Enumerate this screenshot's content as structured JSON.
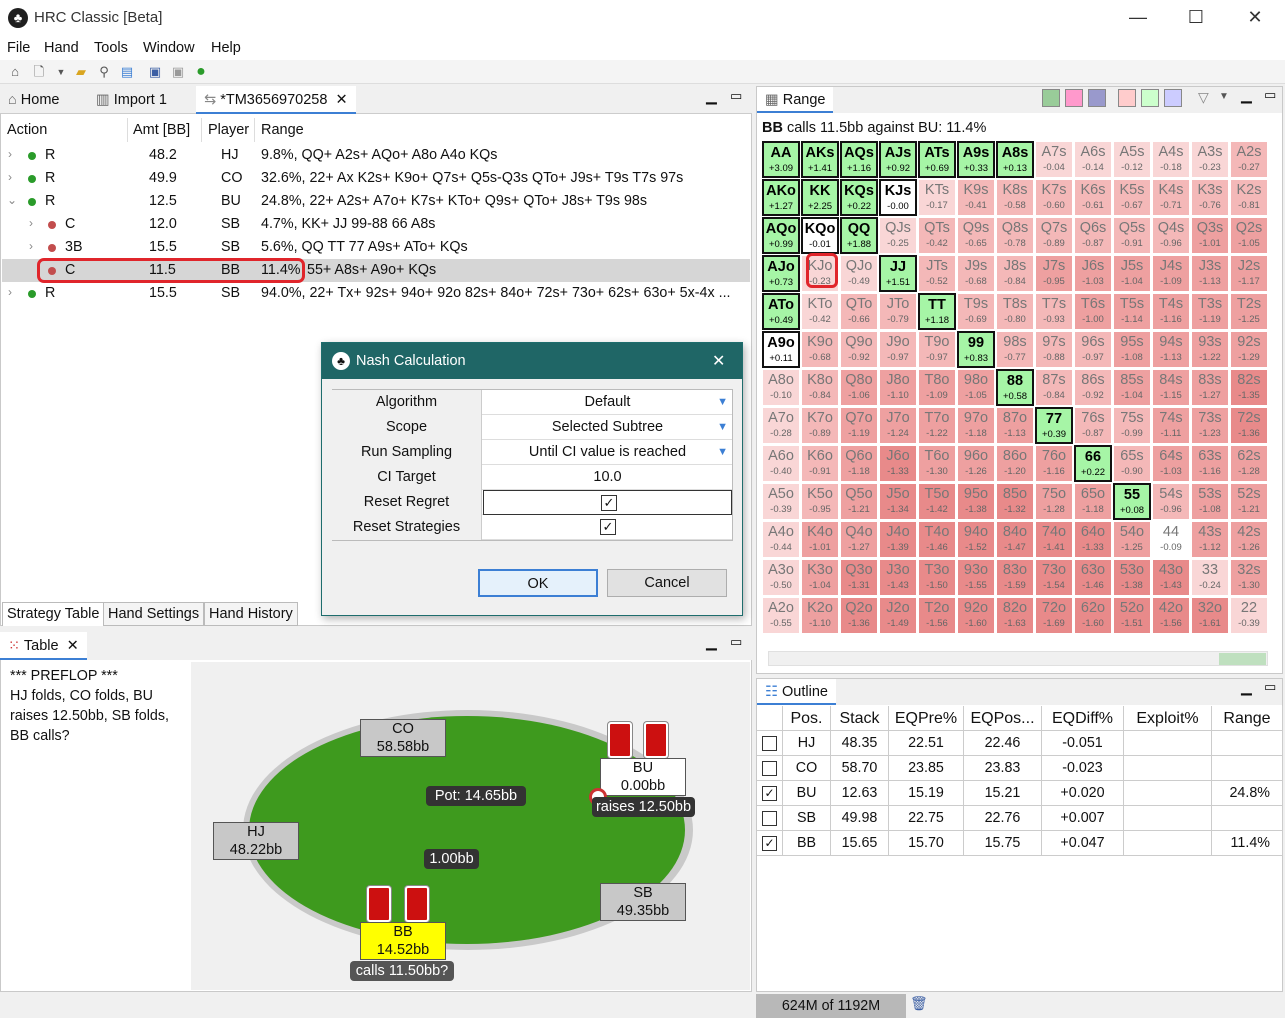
{
  "window": {
    "title": "HRC Classic [Beta]",
    "minimize": "—",
    "maximize": "☐",
    "close": "✕"
  },
  "menu": [
    "File",
    "Hand",
    "Tools",
    "Window",
    "Help"
  ],
  "editor_tabs": {
    "home": "Home",
    "import": "Import 1",
    "tm": "*TM3656970258"
  },
  "strategy_table": {
    "headers": {
      "action": "Action",
      "amt": "Amt [BB]",
      "player": "Player",
      "range": "Range"
    },
    "rows": [
      {
        "action": "R",
        "amt": "48.2",
        "player": "HJ",
        "range": "9.8%, QQ+ A2s+ AQo+ A8o A4o KQs"
      },
      {
        "action": "R",
        "amt": "49.9",
        "player": "CO",
        "range": "32.6%, 22+ Ax K2s+ K9o+ Q7s+ Q5s-Q3s QTo+ J9s+ T9s T7s 97s"
      },
      {
        "action": "R",
        "amt": "12.5",
        "player": "BU",
        "range": "24.8%, 22+ A2s+ A7o+ K7s+ KTo+ Q9s+ QTo+ J8s+ T9s 98s"
      },
      {
        "action": "C",
        "amt": "12.0",
        "player": "SB",
        "range": "4.7%, KK+ JJ 99-88 66 A8s"
      },
      {
        "action": "3B",
        "amt": "15.5",
        "player": "SB",
        "range": "5.6%, QQ TT 77 A9s+ ATo+ KQs"
      },
      {
        "action": "C",
        "amt": "11.5",
        "player": "BB",
        "range_pct": "11.4%",
        "range": "55+ A8s+ A9o+ KQs"
      },
      {
        "action": "R",
        "amt": "15.5",
        "player": "SB",
        "range": "94.0%, 22+ Tx+ 92s+ 94o+ 92o 82s+ 84o+ 72s+ 73o+ 62s+ 63o+ 5x-4x ..."
      }
    ]
  },
  "bottom_tabs": [
    "Strategy Table",
    "Hand Settings",
    "Hand History"
  ],
  "table_panel": {
    "tab": "Table",
    "history": [
      "*** PREFLOP ***",
      "HJ folds, CO folds, BU",
      "raises 12.50bb, SB folds,",
      "BB calls?"
    ],
    "pot": "Pot:    14.65bb",
    "center_bet": "1.00bb",
    "seats": {
      "co": {
        "name": "CO",
        "stack": "58.58bb"
      },
      "bu": {
        "name": "BU",
        "stack": "0.00bb",
        "action": "raises 12.50bb"
      },
      "hj": {
        "name": "HJ",
        "stack": "48.22bb"
      },
      "sb": {
        "name": "SB",
        "stack": "49.35bb"
      },
      "bb": {
        "name": "BB",
        "stack": "14.52bb",
        "action": "calls 11.50bb?"
      }
    }
  },
  "dialog": {
    "title": "Nash Calculation",
    "fields": [
      {
        "label": "Algorithm",
        "value": "Default"
      },
      {
        "label": "Scope",
        "value": "Selected Subtree"
      },
      {
        "label": "Run Sampling",
        "value": "Until CI value is reached"
      },
      {
        "label": "CI Target",
        "value": "10.0"
      },
      {
        "label": "Reset Regret",
        "value": "✓"
      },
      {
        "label": "Reset Strategies",
        "value": "✓"
      }
    ],
    "ok": "OK",
    "cancel": "Cancel"
  },
  "range_panel": {
    "tab": "Range",
    "subtitle_bold": "BB",
    "subtitle": " calls 11.5bb against BU: 11.4%",
    "grid": [
      [
        [
          "AA",
          "+3.09",
          "g"
        ],
        [
          "AKs",
          "+1.41",
          "g"
        ],
        [
          "AQs",
          "+1.16",
          "g"
        ],
        [
          "AJs",
          "+0.92",
          "g"
        ],
        [
          "ATs",
          "+0.69",
          "g"
        ],
        [
          "A9s",
          "+0.33",
          "g"
        ],
        [
          "A8s",
          "+0.13",
          "g"
        ],
        [
          "A7s",
          "-0.04",
          "p0"
        ],
        [
          "A6s",
          "-0.14",
          "p0"
        ],
        [
          "A5s",
          "-0.12",
          "p0"
        ],
        [
          "A4s",
          "-0.18",
          "p0"
        ],
        [
          "A3s",
          "-0.23",
          "p0"
        ],
        [
          "A2s",
          "-0.27",
          "p1"
        ]
      ],
      [
        [
          "AKo",
          "+1.27",
          "g"
        ],
        [
          "KK",
          "+2.25",
          "g"
        ],
        [
          "KQs",
          "+0.22",
          "g"
        ],
        [
          "KJs",
          "-0.00",
          "w"
        ],
        [
          "KTs",
          "-0.17",
          "p0"
        ],
        [
          "K9s",
          "-0.41",
          "p1"
        ],
        [
          "K8s",
          "-0.58",
          "p1"
        ],
        [
          "K7s",
          "-0.60",
          "p1"
        ],
        [
          "K6s",
          "-0.61",
          "p1"
        ],
        [
          "K5s",
          "-0.67",
          "p1"
        ],
        [
          "K4s",
          "-0.71",
          "p1"
        ],
        [
          "K3s",
          "-0.76",
          "p1"
        ],
        [
          "K2s",
          "-0.81",
          "p1"
        ]
      ],
      [
        [
          "AQo",
          "+0.99",
          "g"
        ],
        [
          "KQo",
          "-0.01",
          "w"
        ],
        [
          "QQ",
          "+1.88",
          "g"
        ],
        [
          "QJs",
          "-0.25",
          "p0"
        ],
        [
          "QTs",
          "-0.42",
          "p1"
        ],
        [
          "Q9s",
          "-0.65",
          "p1"
        ],
        [
          "Q8s",
          "-0.78",
          "p1"
        ],
        [
          "Q7s",
          "-0.89",
          "p1"
        ],
        [
          "Q6s",
          "-0.87",
          "p1"
        ],
        [
          "Q5s",
          "-0.91",
          "p1"
        ],
        [
          "Q4s",
          "-0.96",
          "p1"
        ],
        [
          "Q3s",
          "-1.01",
          "p2"
        ],
        [
          "Q2s",
          "-1.05",
          "p2"
        ]
      ],
      [
        [
          "AJo",
          "+0.73",
          "g"
        ],
        [
          "KJo",
          "-0.23",
          "p0"
        ],
        [
          "QJo",
          "-0.49",
          "p0"
        ],
        [
          "JJ",
          "+1.51",
          "g"
        ],
        [
          "JTs",
          "-0.52",
          "p1"
        ],
        [
          "J9s",
          "-0.68",
          "p1"
        ],
        [
          "J8s",
          "-0.84",
          "p1"
        ],
        [
          "J7s",
          "-0.95",
          "p2"
        ],
        [
          "J6s",
          "-1.03",
          "p2"
        ],
        [
          "J5s",
          "-1.04",
          "p2"
        ],
        [
          "J4s",
          "-1.09",
          "p2"
        ],
        [
          "J3s",
          "-1.13",
          "p2"
        ],
        [
          "J2s",
          "-1.17",
          "p2"
        ]
      ],
      [
        [
          "ATo",
          "+0.49",
          "g"
        ],
        [
          "KTo",
          "-0.42",
          "p0"
        ],
        [
          "QTo",
          "-0.66",
          "p1"
        ],
        [
          "JTo",
          "-0.79",
          "p1"
        ],
        [
          "TT",
          "+1.18",
          "g"
        ],
        [
          "T9s",
          "-0.69",
          "p1"
        ],
        [
          "T8s",
          "-0.80",
          "p1"
        ],
        [
          "T7s",
          "-0.93",
          "p1"
        ],
        [
          "T6s",
          "-1.00",
          "p2"
        ],
        [
          "T5s",
          "-1.14",
          "p2"
        ],
        [
          "T4s",
          "-1.16",
          "p2"
        ],
        [
          "T3s",
          "-1.19",
          "p2"
        ],
        [
          "T2s",
          "-1.25",
          "p2"
        ]
      ],
      [
        [
          "A9o",
          "+0.11",
          "w"
        ],
        [
          "K9o",
          "-0.68",
          "p1"
        ],
        [
          "Q9o",
          "-0.92",
          "p1"
        ],
        [
          "J9o",
          "-0.97",
          "p1"
        ],
        [
          "T9o",
          "-0.97",
          "p1"
        ],
        [
          "99",
          "+0.83",
          "g"
        ],
        [
          "98s",
          "-0.77",
          "p1"
        ],
        [
          "97s",
          "-0.88",
          "p1"
        ],
        [
          "96s",
          "-0.97",
          "p1"
        ],
        [
          "95s",
          "-1.08",
          "p2"
        ],
        [
          "94s",
          "-1.13",
          "p2"
        ],
        [
          "93s",
          "-1.22",
          "p2"
        ],
        [
          "92s",
          "-1.29",
          "p2"
        ]
      ],
      [
        [
          "A8o",
          "-0.10",
          "p0"
        ],
        [
          "K8o",
          "-0.84",
          "p1"
        ],
        [
          "Q8o",
          "-1.06",
          "p2"
        ],
        [
          "J8o",
          "-1.10",
          "p2"
        ],
        [
          "T8o",
          "-1.09",
          "p2"
        ],
        [
          "98o",
          "-1.05",
          "p2"
        ],
        [
          "88",
          "+0.58",
          "g"
        ],
        [
          "87s",
          "-0.84",
          "p1"
        ],
        [
          "86s",
          "-0.92",
          "p1"
        ],
        [
          "85s",
          "-1.04",
          "p2"
        ],
        [
          "84s",
          "-1.15",
          "p2"
        ],
        [
          "83s",
          "-1.27",
          "p2"
        ],
        [
          "82s",
          "-1.35",
          "p3"
        ]
      ],
      [
        [
          "A7o",
          "-0.28",
          "p0"
        ],
        [
          "K7o",
          "-0.89",
          "p1"
        ],
        [
          "Q7o",
          "-1.19",
          "p2"
        ],
        [
          "J7o",
          "-1.24",
          "p2"
        ],
        [
          "T7o",
          "-1.22",
          "p2"
        ],
        [
          "97o",
          "-1.18",
          "p2"
        ],
        [
          "87o",
          "-1.13",
          "p2"
        ],
        [
          "77",
          "+0.39",
          "g"
        ],
        [
          "76s",
          "-0.87",
          "p1"
        ],
        [
          "75s",
          "-0.99",
          "p1"
        ],
        [
          "74s",
          "-1.11",
          "p2"
        ],
        [
          "73s",
          "-1.23",
          "p2"
        ],
        [
          "72s",
          "-1.36",
          "p3"
        ]
      ],
      [
        [
          "A6o",
          "-0.40",
          "p0"
        ],
        [
          "K6o",
          "-0.91",
          "p1"
        ],
        [
          "Q6o",
          "-1.18",
          "p2"
        ],
        [
          "J6o",
          "-1.33",
          "p3"
        ],
        [
          "T6o",
          "-1.30",
          "p2"
        ],
        [
          "96o",
          "-1.26",
          "p2"
        ],
        [
          "86o",
          "-1.20",
          "p2"
        ],
        [
          "76o",
          "-1.16",
          "p2"
        ],
        [
          "66",
          "+0.22",
          "g"
        ],
        [
          "65s",
          "-0.90",
          "p1"
        ],
        [
          "64s",
          "-1.03",
          "p2"
        ],
        [
          "63s",
          "-1.16",
          "p2"
        ],
        [
          "62s",
          "-1.28",
          "p2"
        ]
      ],
      [
        [
          "A5o",
          "-0.39",
          "p0"
        ],
        [
          "K5o",
          "-0.95",
          "p1"
        ],
        [
          "Q5o",
          "-1.21",
          "p2"
        ],
        [
          "J5o",
          "-1.34",
          "p3"
        ],
        [
          "T5o",
          "-1.42",
          "p3"
        ],
        [
          "95o",
          "-1.38",
          "p3"
        ],
        [
          "85o",
          "-1.32",
          "p3"
        ],
        [
          "75o",
          "-1.28",
          "p2"
        ],
        [
          "65o",
          "-1.18",
          "p2"
        ],
        [
          "55",
          "+0.08",
          "g"
        ],
        [
          "54s",
          "-0.96",
          "p1"
        ],
        [
          "53s",
          "-1.08",
          "p2"
        ],
        [
          "52s",
          "-1.21",
          "p2"
        ]
      ],
      [
        [
          "A4o",
          "-0.44",
          "p0"
        ],
        [
          "K4o",
          "-1.01",
          "p2"
        ],
        [
          "Q4o",
          "-1.27",
          "p2"
        ],
        [
          "J4o",
          "-1.39",
          "p3"
        ],
        [
          "T4o",
          "-1.46",
          "p3"
        ],
        [
          "94o",
          "-1.52",
          "p3"
        ],
        [
          "84o",
          "-1.47",
          "p3"
        ],
        [
          "74o",
          "-1.41",
          "p3"
        ],
        [
          "64o",
          "-1.33",
          "p3"
        ],
        [
          "54o",
          "-1.25",
          "p2"
        ],
        [
          "44",
          "-0.09",
          "w0"
        ],
        [
          "43s",
          "-1.12",
          "p2"
        ],
        [
          "42s",
          "-1.26",
          "p2"
        ]
      ],
      [
        [
          "A3o",
          "-0.50",
          "p0"
        ],
        [
          "K3o",
          "-1.04",
          "p2"
        ],
        [
          "Q3o",
          "-1.31",
          "p3"
        ],
        [
          "J3o",
          "-1.43",
          "p3"
        ],
        [
          "T3o",
          "-1.50",
          "p3"
        ],
        [
          "93o",
          "-1.55",
          "p3"
        ],
        [
          "83o",
          "-1.59",
          "p3"
        ],
        [
          "73o",
          "-1.54",
          "p3"
        ],
        [
          "63o",
          "-1.46",
          "p3"
        ],
        [
          "53o",
          "-1.38",
          "p3"
        ],
        [
          "43o",
          "-1.43",
          "p3"
        ],
        [
          "33",
          "-0.24",
          "p0"
        ],
        [
          "32s",
          "-1.30",
          "p2"
        ]
      ],
      [
        [
          "A2o",
          "-0.55",
          "p0"
        ],
        [
          "K2o",
          "-1.10",
          "p2"
        ],
        [
          "Q2o",
          "-1.36",
          "p3"
        ],
        [
          "J2o",
          "-1.49",
          "p3"
        ],
        [
          "T2o",
          "-1.56",
          "p3"
        ],
        [
          "92o",
          "-1.60",
          "p3"
        ],
        [
          "82o",
          "-1.63",
          "p3"
        ],
        [
          "72o",
          "-1.69",
          "p3"
        ],
        [
          "62o",
          "-1.60",
          "p3"
        ],
        [
          "52o",
          "-1.51",
          "p3"
        ],
        [
          "42o",
          "-1.56",
          "p3"
        ],
        [
          "32o",
          "-1.61",
          "p3"
        ],
        [
          "22",
          "-0.39",
          "p0"
        ]
      ]
    ]
  },
  "outline": {
    "tab": "Outline",
    "headers": [
      "Pos.",
      "Stack",
      "EQPre%",
      "EQPos...",
      "EQDiff%",
      "Exploit%",
      "Range"
    ],
    "rows": [
      {
        "checked": false,
        "pos": "HJ",
        "stack": "48.35",
        "eqpre": "22.51",
        "eqpos": "22.46",
        "eqdiff": "-0.051",
        "exploit": "",
        "range": ""
      },
      {
        "checked": false,
        "pos": "CO",
        "stack": "58.70",
        "eqpre": "23.85",
        "eqpos": "23.83",
        "eqdiff": "-0.023",
        "exploit": "",
        "range": ""
      },
      {
        "checked": true,
        "pos": "BU",
        "stack": "12.63",
        "eqpre": "15.19",
        "eqpos": "15.21",
        "eqdiff": "+0.020",
        "exploit": "",
        "range": "24.8%"
      },
      {
        "checked": false,
        "pos": "SB",
        "stack": "49.98",
        "eqpre": "22.75",
        "eqpos": "22.76",
        "eqdiff": "+0.007",
        "exploit": "",
        "range": ""
      },
      {
        "checked": true,
        "pos": "BB",
        "stack": "15.65",
        "eqpre": "15.70",
        "eqpos": "15.75",
        "eqdiff": "+0.047",
        "exploit": "",
        "range": "11.4%"
      }
    ]
  },
  "status": {
    "memory": "624M of 1192M"
  },
  "colors": {
    "green": "#a6f5a6",
    "white": "#ffffff",
    "p0": "#f9d6d6",
    "p1": "#f4b8b8",
    "p2": "#eea0a0",
    "p3": "#e88a8a",
    "highlight": "#e0252b",
    "felt": "#3e9a1e"
  }
}
